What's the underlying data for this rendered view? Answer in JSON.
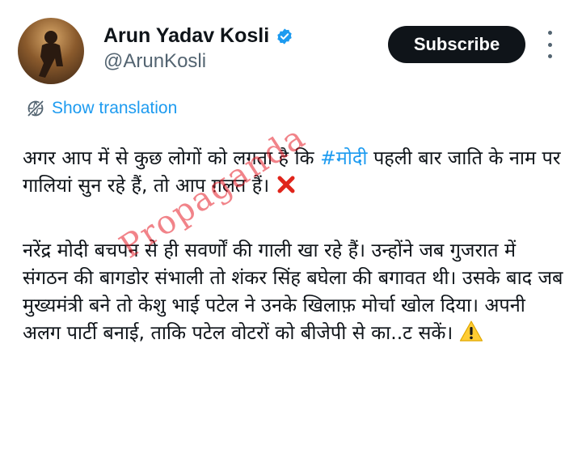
{
  "author": {
    "name": "Arun Yadav Kosli",
    "handle": "@ArunKosli",
    "verified": true,
    "avatar_icon": "profile-photo"
  },
  "subscribe_label": "Subscribe",
  "translation_label": "Show translation",
  "tweet": {
    "p1_before": "अगर आप में से कुछ लोगों को लगता है कि ",
    "hashtag": "#मोदी",
    "p1_after": " पहली बार जाति के नाम पर गालियां सुन रहे हैं, तो आप ग़लत हैं। ",
    "p1_emoji": "cross-mark-icon",
    "p2": "नरेंद्र मोदी बचपन से ही सवर्णों की गाली खा रहे हैं। उन्होंने जब गुजरात में संगठन की बागडोर संभाली तो शंकर सिंह बघेला की बगावत थी। उसके बाद जब मुख्यमंत्री बने तो केशु भाई पटेल ने उनके खिलाफ़ मोर्चा खोल दिया। अपनी अलग पार्टी बनाई, ताकि पटेल वोटरों को बीजेपी से का..ट सकें। ",
    "p2_emoji": "warning-icon"
  },
  "watermark": "Propaganda",
  "colors": {
    "accent": "#1d9bf0",
    "text": "#0f1419",
    "muted": "#536471",
    "watermark": "#e61e28"
  }
}
